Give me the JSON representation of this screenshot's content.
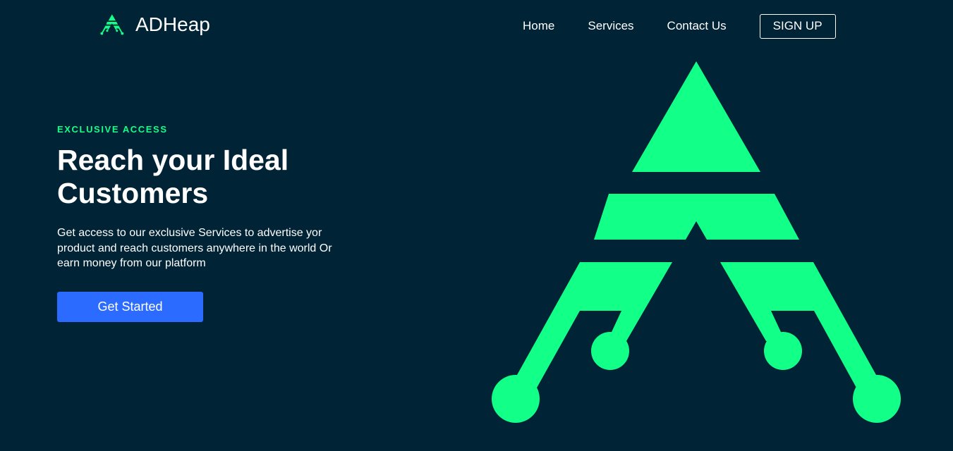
{
  "colors": {
    "background": "#002336",
    "accent": "#12ff88",
    "primary_button": "#2c6bff",
    "text": "#ffffff"
  },
  "header": {
    "brand_name": "ADHeap",
    "brand_icon": "adheap-logo-icon",
    "nav": [
      {
        "label": "Home"
      },
      {
        "label": "Services"
      },
      {
        "label": "Contact Us"
      }
    ],
    "signup_label": "SIGN UP"
  },
  "hero": {
    "eyebrow": "EXCLUSIVE ACCESS",
    "title": "Reach your Ideal Customers",
    "description": "Get access to our exclusive Services to advertise yor product and reach customers anywhere in the world Or earn money from our platform",
    "cta_label": "Get Started",
    "illustration_icon": "adheap-logo-large"
  }
}
